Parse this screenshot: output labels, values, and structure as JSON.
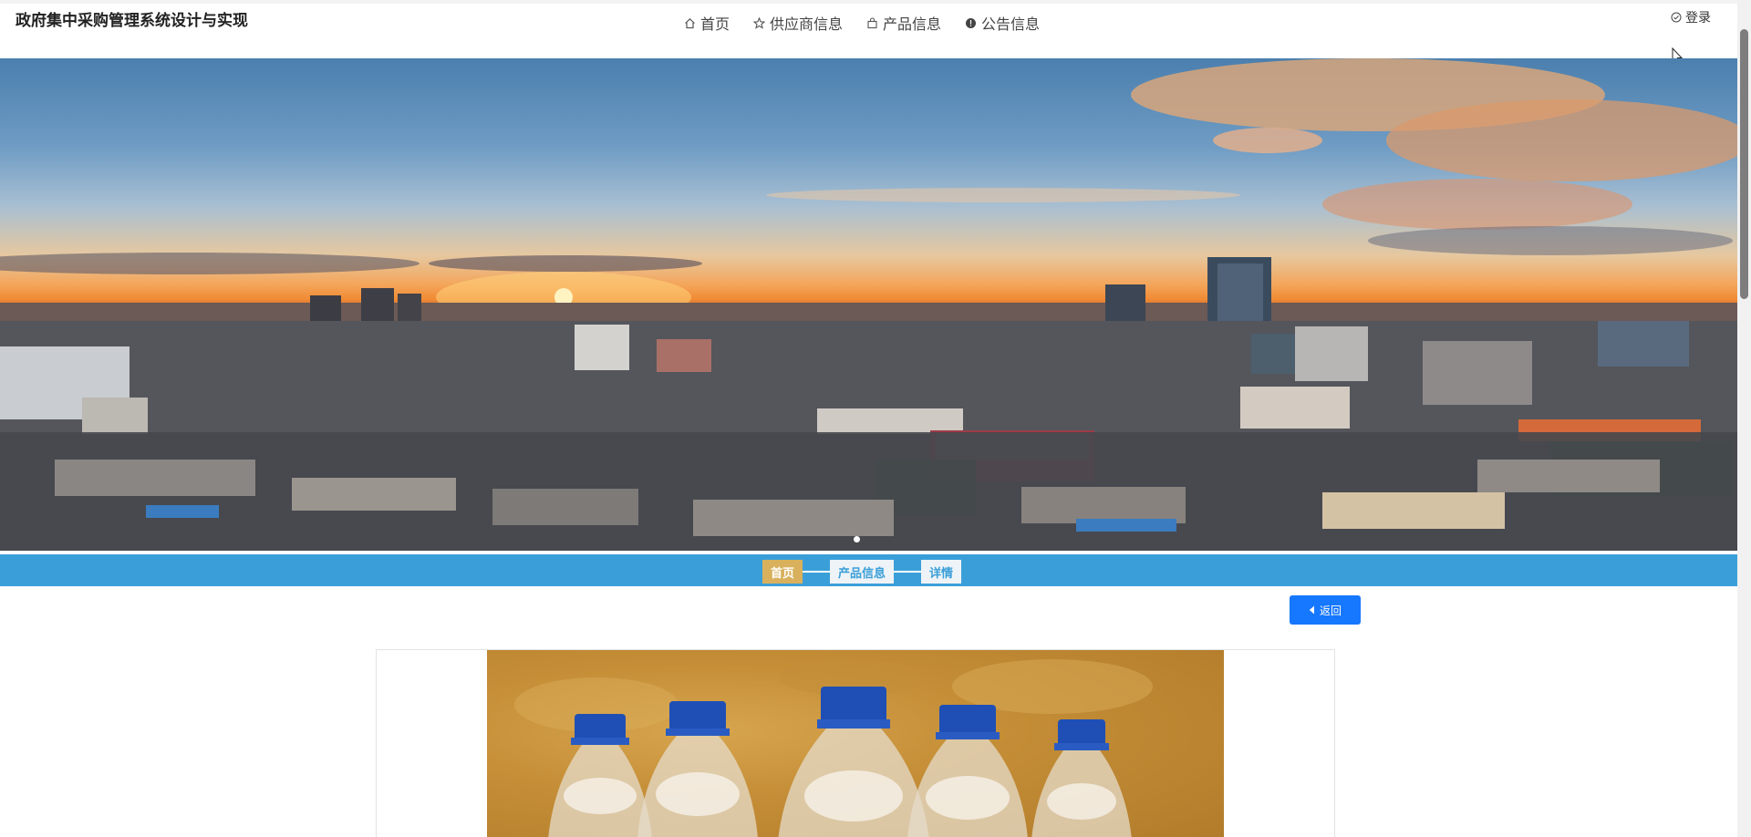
{
  "header": {
    "site_title": "政府集中采购管理系统设计与实现",
    "nav": [
      {
        "label": "首页",
        "icon": "home-icon"
      },
      {
        "label": "供应商信息",
        "icon": "star-icon"
      },
      {
        "label": "产品信息",
        "icon": "bag-icon"
      },
      {
        "label": "公告信息",
        "icon": "info-icon"
      }
    ],
    "login_label": "登录",
    "login_icon": "check-circle-icon"
  },
  "banner": {
    "image": "city-skyline-sunset",
    "active_slide": 1,
    "slide_count": 1
  },
  "breadcrumb": {
    "items": [
      "首页",
      "产品信息",
      "详情"
    ]
  },
  "actions": {
    "back_label": "返回",
    "back_icon": "caret-left-icon"
  },
  "product": {
    "image": "water-bottles-blue-caps"
  },
  "colors": {
    "primary": "#1677ff",
    "crumb_bar": "#3a9fd8",
    "crumb_active": "#d9b15c"
  }
}
